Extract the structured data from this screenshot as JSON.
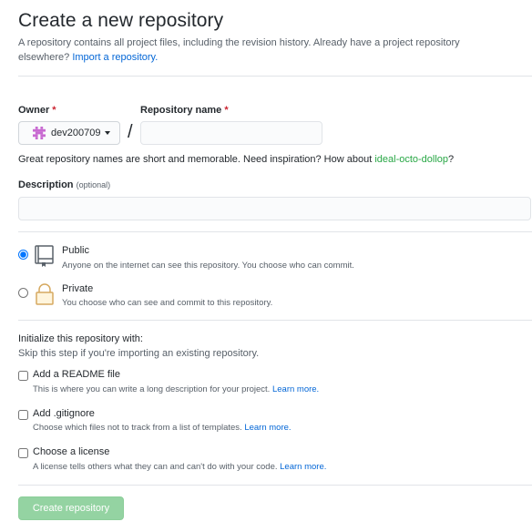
{
  "header": {
    "title": "Create a new repository",
    "subtitle": "A repository contains all project files, including the revision history. Already have a project repository elsewhere?",
    "import_link": "Import a repository."
  },
  "owner": {
    "label": "Owner",
    "required_mark": "*",
    "value": "dev200709"
  },
  "repo_name": {
    "label": "Repository name",
    "required_mark": "*",
    "separator": "/",
    "value": ""
  },
  "name_hint": {
    "prefix": "Great repository names are short and memorable. Need inspiration? How about",
    "suggestion": "ideal-octo-dollop",
    "suffix": "?"
  },
  "description": {
    "label": "Description",
    "optional": "(optional)",
    "value": ""
  },
  "visibility": {
    "public": {
      "title": "Public",
      "desc": "Anyone on the internet can see this repository. You choose who can commit.",
      "selected": true
    },
    "private": {
      "title": "Private",
      "desc": "You choose who can see and commit to this repository.",
      "selected": false
    }
  },
  "init": {
    "heading": "Initialize this repository with:",
    "note": "Skip this step if you're importing an existing repository.",
    "learn_more": "Learn more.",
    "readme": {
      "title": "Add a README file",
      "desc": "This is where you can write a long description for your project.",
      "checked": false
    },
    "gitignore": {
      "title": "Add .gitignore",
      "desc": "Choose which files not to track from a list of templates.",
      "checked": false
    },
    "license": {
      "title": "Choose a license",
      "desc": "A license tells others what they can and can't do with your code.",
      "checked": false
    }
  },
  "submit": {
    "label": "Create repository"
  },
  "colors": {
    "link": "#0366d6",
    "required": "#cb2431",
    "suggestion": "#28a745",
    "button": "#94d3a2"
  },
  "icons": {
    "owner_avatar": "identicon",
    "public": "repo-book-icon",
    "private": "lock-icon",
    "owner_dropdown": "caret-down-icon"
  }
}
